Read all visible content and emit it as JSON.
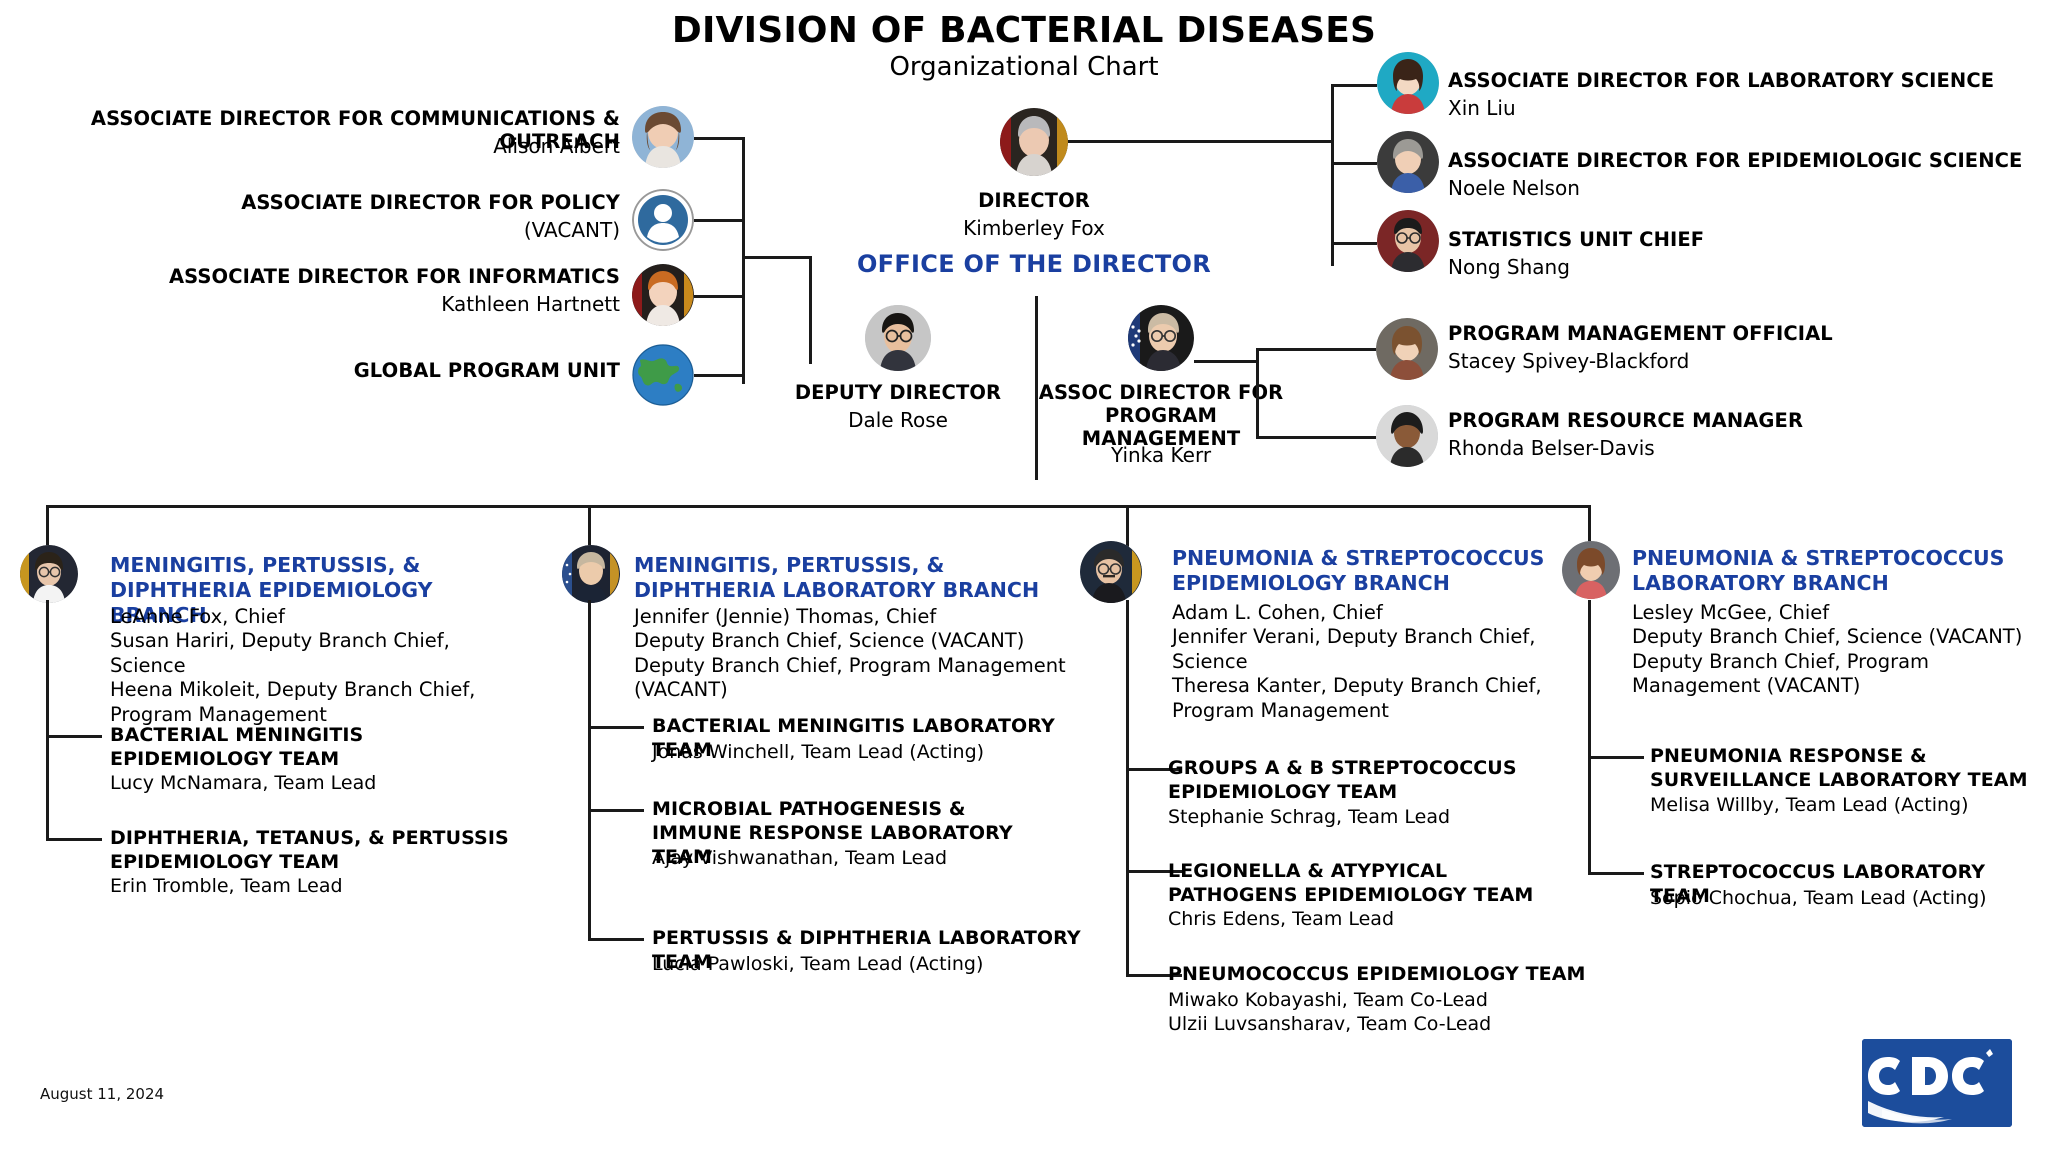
{
  "header": {
    "title": "DIVISION OF BACTERIAL DISEASES",
    "subtitle": "Organizational Chart"
  },
  "office_label": "OFFICE OF THE DIRECTOR",
  "director": {
    "role": "DIRECTOR",
    "person": "Kimberley Fox",
    "avatar": "photo-kimberley-fox"
  },
  "deputy_director": {
    "role": "DEPUTY DIRECTOR",
    "person": "Dale Rose",
    "avatar": "photo-dale-rose"
  },
  "left_staff": [
    {
      "role": "ASSOCIATE DIRECTOR FOR COMMUNICATIONS & OUTREACH",
      "person": "Alison Albert",
      "avatar": "photo-alison-albert"
    },
    {
      "role": "ASSOCIATE DIRECTOR FOR POLICY",
      "person": "(VACANT)",
      "avatar": "placeholder-person-icon"
    },
    {
      "role": "ASSOCIATE DIRECTOR FOR INFORMATICS",
      "person": "Kathleen Hartnett",
      "avatar": "photo-kathleen-hartnett"
    },
    {
      "role": "GLOBAL PROGRAM UNIT",
      "person": "",
      "avatar": "globe-icon"
    }
  ],
  "right_staff": [
    {
      "role": "ASSOCIATE DIRECTOR FOR LABORATORY SCIENCE",
      "person": "Xin Liu",
      "avatar": "photo-xin-liu"
    },
    {
      "role": "ASSOCIATE DIRECTOR FOR EPIDEMIOLOGIC SCIENCE",
      "person": "Noele Nelson",
      "avatar": "photo-noele-nelson"
    },
    {
      "role": "STATISTICS UNIT CHIEF",
      "person": "Nong Shang",
      "avatar": "photo-nong-shang"
    }
  ],
  "program_management": {
    "role_line1": "ASSOC DIRECTOR FOR",
    "role_line2": "PROGRAM MANAGEMENT",
    "person": "Yinka Kerr",
    "avatar": "photo-yinka-kerr",
    "reports": [
      {
        "role": "PROGRAM MANAGEMENT OFFICIAL",
        "person": "Stacey Spivey-Blackford",
        "avatar": "photo-stacey-spivey-blackford"
      },
      {
        "role": "PROGRAM RESOURCE MANAGER",
        "person": "Rhonda Belser-Davis",
        "avatar": "photo-rhonda-belser-davis"
      }
    ]
  },
  "branches": [
    {
      "title": "MENINGITIS, PERTUSSIS, & DIPHTHERIA EPIDEMIOLOGY BRANCH",
      "avatar": "photo-leanne-fox",
      "people": [
        "LeAnne Fox, Chief",
        "Susan Hariri, Deputy Branch Chief, Science",
        "Heena Mikoleit, Deputy Branch Chief, Program Management"
      ],
      "teams": [
        {
          "name": "BACTERIAL MENINGITIS EPIDEMIOLOGY TEAM",
          "lead": "Lucy McNamara, Team Lead"
        },
        {
          "name": "DIPHTHERIA, TETANUS, & PERTUSSIS EPIDEMIOLOGY TEAM",
          "lead": "Erin Tromble, Team Lead"
        }
      ]
    },
    {
      "title": "MENINGITIS, PERTUSSIS, & DIPHTHERIA LABORATORY BRANCH",
      "avatar": "photo-jennifer-thomas",
      "people": [
        "Jennifer (Jennie) Thomas, Chief",
        "Deputy Branch Chief, Science (VACANT)",
        "Deputy Branch Chief, Program Management (VACANT)"
      ],
      "teams": [
        {
          "name": "BACTERIAL MENINGITIS LABORATORY TEAM",
          "lead": "Jonas Winchell, Team Lead (Acting)"
        },
        {
          "name": "MICROBIAL PATHOGENESIS & IMMUNE RESPONSE LABORATORY TEAM",
          "lead": "Ajay Vishwanathan, Team Lead"
        },
        {
          "name": "PERTUSSIS & DIPHTHERIA LABORATORY TEAM",
          "lead": "Lucia Pawloski, Team Lead (Acting)"
        }
      ]
    },
    {
      "title": "PNEUMONIA & STREPTOCOCCUS EPIDEMIOLOGY BRANCH",
      "avatar": "photo-adam-cohen",
      "people": [
        "Adam L. Cohen, Chief",
        "Jennifer Verani, Deputy Branch Chief, Science",
        "Theresa Kanter, Deputy Branch Chief, Program Management"
      ],
      "teams": [
        {
          "name": "GROUPS A & B STREPTOCOCCUS EPIDEMIOLOGY TEAM",
          "lead": "Stephanie Schrag, Team Lead"
        },
        {
          "name": "LEGIONELLA & ATYPYICAL PATHOGENS EPIDEMIOLOGY TEAM",
          "lead": "Chris Edens, Team Lead"
        },
        {
          "name": "PNEUMOCOCCUS EPIDEMIOLOGY TEAM",
          "lead": "Miwako Kobayashi, Team Co-Lead\nUlzii Luvsansharav, Team Co-Lead"
        }
      ]
    },
    {
      "title": "PNEUMONIA & STREPTOCOCCUS LABORATORY BRANCH",
      "avatar": "photo-lesley-mcgee",
      "people": [
        "Lesley McGee, Chief",
        "Deputy Branch Chief, Science (VACANT)",
        "Deputy Branch Chief, Program Management (VACANT)"
      ],
      "teams": [
        {
          "name": "PNEUMONIA RESPONSE & SURVEILLANCE LABORATORY TEAM",
          "lead": "Melisa Willby, Team Lead (Acting)"
        },
        {
          "name": "STREPTOCOCCUS LABORATORY TEAM",
          "lead": "Sopio Chochua, Team Lead (Acting)"
        }
      ]
    }
  ],
  "footer": {
    "date": "August 11, 2024",
    "logo_text": "CDC"
  },
  "colors": {
    "heading_blue": "#1a3fa0",
    "line_black": "#1a1a1a",
    "cdc_blue": "#1c4d9c"
  }
}
